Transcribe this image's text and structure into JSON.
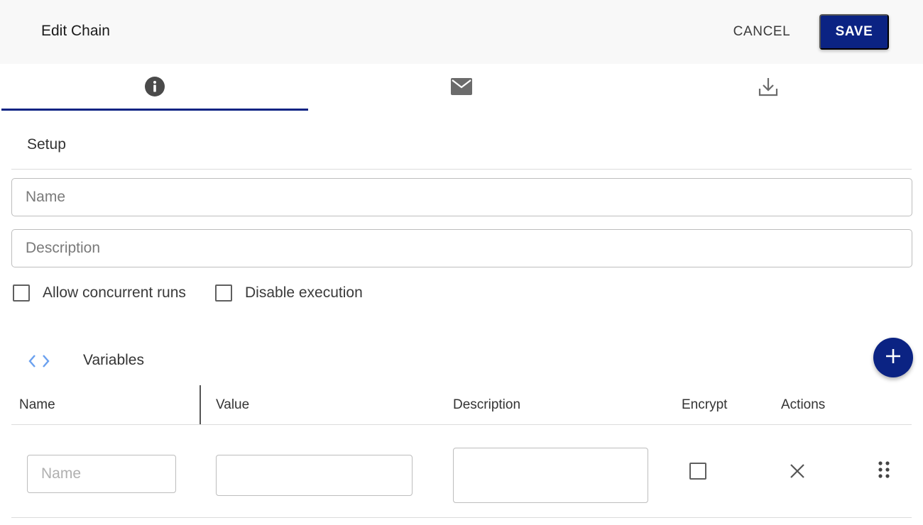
{
  "header": {
    "title": "Edit Chain",
    "cancel_label": "CANCEL",
    "save_label": "SAVE"
  },
  "tabs": [
    {
      "icon": "info-icon",
      "active": true
    },
    {
      "icon": "mail-icon",
      "active": false
    },
    {
      "icon": "download-icon",
      "active": false
    }
  ],
  "setup": {
    "section_title": "Setup",
    "name_field": {
      "value": "",
      "placeholder": "Name"
    },
    "description_field": {
      "value": "",
      "placeholder": "Description"
    },
    "allow_concurrent_runs": {
      "label": "Allow concurrent runs",
      "checked": false
    },
    "disable_execution": {
      "label": "Disable execution",
      "checked": false
    }
  },
  "variables": {
    "section_title": "Variables",
    "section_icon": "code-brackets-icon",
    "add_icon": "add-icon",
    "columns": [
      "Name",
      "Value",
      "Description",
      "Encrypt",
      "Actions"
    ],
    "rows": [
      {
        "name": {
          "value": "",
          "placeholder": "Name"
        },
        "value": {
          "value": "",
          "placeholder": ""
        },
        "description": {
          "value": "",
          "placeholder": ""
        },
        "encrypt": false,
        "delete_icon": "close-icon",
        "drag_icon": "drag-handle-icon"
      }
    ]
  },
  "colors": {
    "primary": "#0b2383",
    "header_bg": "#f8f8f8",
    "icon_grey": "#666666",
    "accent_light_blue": "#6aa0ef"
  }
}
